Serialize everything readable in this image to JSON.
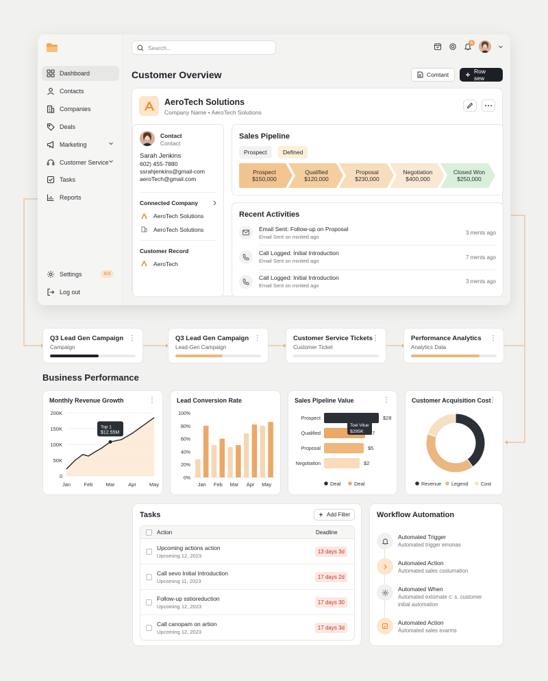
{
  "search": {
    "placeholder": "Search..."
  },
  "notifications": {
    "count": "6"
  },
  "sidebar": {
    "items": [
      {
        "label": "Dashboard"
      },
      {
        "label": "Contacts"
      },
      {
        "label": "Companies"
      },
      {
        "label": "Deals"
      },
      {
        "label": "Marketing"
      },
      {
        "label": "Customer Service"
      },
      {
        "label": "Tasks"
      },
      {
        "label": "Reports"
      }
    ],
    "settings": "Settings",
    "settings_badge": "0.0",
    "logout": "Log out"
  },
  "header": {
    "title": "Customer Overview",
    "contact_btn": "Comtant",
    "new_btn": "Row sew"
  },
  "company": {
    "name": "AeroTech Solutions",
    "subtitle": "Company Name • AeroTech Solutions"
  },
  "contact": {
    "heading": "Contact",
    "subheading": "Contact",
    "name": "Sarah Jenkins",
    "phone": "602) 455-7880",
    "email1": "ssrahjenkins@gmail-com",
    "email2": "aeroTech@gmail.com",
    "connected_title": "Connected Company",
    "connected": [
      "AeroTech Solutions",
      "AeroTech Solutions"
    ],
    "record_title": "Customer Record",
    "record": "AeroTech"
  },
  "pipeline": {
    "title": "Sales Pipeline",
    "chips": [
      "Prospect",
      "Defined"
    ],
    "stages": [
      {
        "name": "Prospect",
        "value": "$150,000"
      },
      {
        "name": "Qualified",
        "value": "$120,000"
      },
      {
        "name": "Proposal",
        "value": "$230,000"
      },
      {
        "name": "Negotiation",
        "value": "$400,000"
      },
      {
        "name": "Closed Won",
        "value": "$250,000"
      }
    ]
  },
  "activities": {
    "title": "Recent Activities",
    "items": [
      {
        "title": "Email Sent: Follow-up on Proposal",
        "sub": "Email Sent on minited ago",
        "time": "3 ments ago",
        "icon": "mail-icon"
      },
      {
        "title": "Call Logged: Initial Introduction",
        "sub": "Email Sent on minited ago",
        "time": "7 ments ago",
        "icon": "phone-icon"
      },
      {
        "title": "Call Logged: Initial Introduction",
        "sub": "Email Sent on minited ago",
        "time": "3 ments ago",
        "icon": "phone-icon"
      }
    ]
  },
  "flow": [
    {
      "title": "Q3 Lead Gen Campaign",
      "sub": "Campaign",
      "progress": 0.57,
      "color": "#1f2328"
    },
    {
      "title": "Q3 Lead Gen Campaign",
      "sub": "Lead-Gen Campaign",
      "progress": 0.55,
      "color": "#edb77e"
    },
    {
      "title": "Customer Service Tickets",
      "sub": "Customer Ticket",
      "progress": 0.0,
      "color": "#edb77e"
    },
    {
      "title": "Performance Analytics",
      "sub": "Analytics Data",
      "progress": 0.8,
      "color": "#edb77e"
    }
  ],
  "business": {
    "title": "Business Performance"
  },
  "charts": {
    "revenue": {
      "title": "Monthly Revenue Growth",
      "tooltip1": "Top 1",
      "tooltip2": "$12.55M",
      "yticks": [
        "200K",
        "150K",
        "100K",
        "50K",
        "0"
      ],
      "xticks": [
        "Jan",
        "Feb",
        "Mar",
        "Apr",
        "May"
      ]
    },
    "conversion": {
      "title": "Lead Conversion Rate",
      "yticks": [
        "100%",
        "80%",
        "60%",
        "40%",
        "20%",
        "0%"
      ],
      "xticks": [
        "Jan",
        "Feb",
        "Mar",
        "Apr",
        "May"
      ]
    },
    "pipeline_value": {
      "title": "Sales Pipeline Value",
      "tooltip1": "Toel Vitue",
      "tooltip2": "$295K",
      "labels": [
        "Prospect",
        "Qualified",
        "Proposal",
        "Negotiation"
      ],
      "values": [
        "$28",
        "$7",
        "$5",
        "$2"
      ],
      "legend": [
        "Deal",
        "Deal"
      ]
    },
    "acquisition": {
      "title": "Customer Acquisition Cost",
      "legend": [
        "Revenue",
        "Legend",
        "Cost"
      ]
    }
  },
  "chart_data": [
    {
      "type": "line",
      "title": "Monthly Revenue Growth",
      "x": [
        "Jan",
        "Feb",
        "Mar",
        "Apr",
        "May"
      ],
      "x_pos": [
        0,
        0.4,
        0.75,
        1.0,
        1.3,
        1.6,
        2.0,
        2.5,
        3.0,
        3.5,
        4.0
      ],
      "y": [
        22,
        50,
        68,
        63,
        76,
        88,
        108,
        115,
        135,
        160,
        185
      ],
      "ylim": [
        0,
        200
      ],
      "unit": "K"
    },
    {
      "type": "bar",
      "title": "Lead Conversion Rate",
      "categories": [
        "",
        "Jan",
        "",
        "Feb",
        "",
        "Mar",
        "",
        "Apr",
        "",
        "May"
      ],
      "values": [
        28,
        80,
        50,
        60,
        47,
        50,
        68,
        82,
        80,
        86
      ],
      "ylim": [
        0,
        100
      ],
      "unit": "%"
    },
    {
      "type": "bar",
      "orientation": "horizontal",
      "title": "Sales Pipeline Value",
      "categories": [
        "Prospect",
        "Qualified",
        "Proposal",
        "Negotiation"
      ],
      "values": [
        28,
        7,
        5,
        2
      ]
    },
    {
      "type": "pie",
      "title": "Customer Acquisition Cost",
      "labels": [
        "Revenue",
        "Legend",
        "Cost"
      ],
      "values": [
        40,
        40,
        20
      ],
      "colors": [
        "#2b2f36",
        "#e9b77f",
        "#f7dfc3"
      ]
    }
  ],
  "tasks": {
    "title": "Tasks",
    "add_filter": "Add Filter",
    "col_action": "Action",
    "col_deadline": "Deadline",
    "rows": [
      {
        "title": "Upcoming actions action",
        "date": "Upcoming 12, 2023",
        "due": "13 days 3d"
      },
      {
        "title": "Call sevo Initial Introduction",
        "date": "Upcoming 11, 2023",
        "due": "17 days 2d"
      },
      {
        "title": "Follow-up sstioreduction",
        "date": "Upcoming 12, 2023",
        "due": "17 days 30"
      },
      {
        "title": "Call canopam on artion",
        "date": "Upcoming 12, 2023",
        "due": "17 days 3d"
      }
    ]
  },
  "workflow": {
    "title": "Workflow Automation",
    "items": [
      {
        "title": "Automated Trigger",
        "sub": "Automated trigger emonas",
        "sub2": ""
      },
      {
        "title": "Automated Action",
        "sub": "Automated sales cssturnation",
        "sub2": ""
      },
      {
        "title": "Automated When",
        "sub": "Automated extomate c: s. customer",
        "sub2": "initial automation"
      },
      {
        "title": "Automated Action",
        "sub": "Automated sales exarms",
        "sub2": ""
      }
    ]
  }
}
